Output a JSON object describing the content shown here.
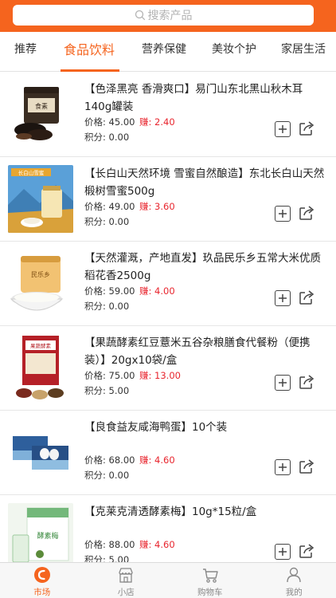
{
  "search": {
    "placeholder": "搜索产品"
  },
  "tabs": [
    {
      "label": "推荐"
    },
    {
      "label": "食品饮料"
    },
    {
      "label": "营养保健"
    },
    {
      "label": "美妆个护"
    },
    {
      "label": "家居生活"
    }
  ],
  "labels": {
    "price": "价格:",
    "earn": "赚:",
    "points": "积分:"
  },
  "products": [
    {
      "title": "【色泽黑亮 香滑爽口】易门山东北黑山秋木耳140g罐装",
      "price": "45.00",
      "earn": "2.40",
      "points": "0.00",
      "thumb_text": "食素"
    },
    {
      "title": "【长白山天然环境 雪蜜自然酿造】东北长白山天然椴树雪蜜500g",
      "price": "49.00",
      "earn": "3.60",
      "points": "0.00",
      "thumb_text": "长白山雪蜜"
    },
    {
      "title": "【天然灌溉，产地直发】玖品民乐乡五常大米优质稻花香2500g",
      "price": "59.00",
      "earn": "4.00",
      "points": "0.00",
      "thumb_text": "民乐乡"
    },
    {
      "title": "【果蔬酵素红豆薏米五谷杂粮膳食代餐粉（便携装）】20gx10袋/盒",
      "price": "75.00",
      "earn": "13.00",
      "points": "5.00",
      "thumb_text": "果蔬酵素"
    },
    {
      "title": "【良食益友咸海鸭蛋】10个装",
      "price": "68.00",
      "earn": "4.60",
      "points": "0.00",
      "thumb_text": ""
    },
    {
      "title": "【克莱克清透酵素梅】10g*15粒/盒",
      "price": "88.00",
      "earn": "4.60",
      "points": "5.00",
      "thumb_text": "酵素梅"
    }
  ],
  "nav": [
    {
      "label": "市场",
      "icon": "market-icon"
    },
    {
      "label": "小店",
      "icon": "shop-icon"
    },
    {
      "label": "购物车",
      "icon": "cart-icon"
    },
    {
      "label": "我的",
      "icon": "user-icon"
    }
  ],
  "colors": {
    "brand": "#f5641e",
    "earn": "#e8252e"
  }
}
